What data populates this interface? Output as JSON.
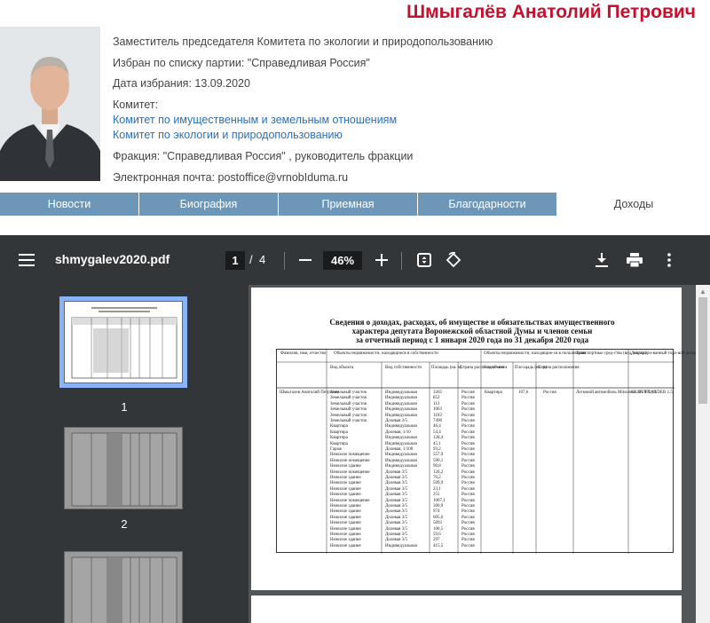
{
  "deputy": {
    "name": "Шмыгалёв Анатолий Петрович",
    "position": "Заместитель председателя Комитета по экологии и природопользованию",
    "elected_by": "Избран по списку партии:  \"Справедливая Россия\"",
    "election_date": "Дата избрания:  13.09.2020",
    "committee_label": "Комитет:",
    "committees": [
      "Комитет по имущественным и земельным отношениям",
      "Комитет по экологии и природопользованию"
    ],
    "faction": "Фракция:  \"Справедливая Россия\" , руководитель фракции",
    "email": "Электронная почта:  postoffice@vrnobIduma.ru"
  },
  "tabs": [
    {
      "label": "Новости",
      "active": false
    },
    {
      "label": "Биография",
      "active": false
    },
    {
      "label": "Приемная",
      "active": false
    },
    {
      "label": "Благодарности",
      "active": false
    },
    {
      "label": "Доходы",
      "active": true
    }
  ],
  "pdf_viewer": {
    "file_name": "shmygalev2020.pdf",
    "current_page": "1",
    "page_separator": "/",
    "total_pages": "4",
    "zoom": "46%",
    "icons": [
      "menu-icon",
      "zoom-out-icon",
      "zoom-in-icon",
      "fit-page-icon",
      "rotate-icon",
      "download-icon",
      "print-icon",
      "more-icon"
    ],
    "thumbnails": [
      "1",
      "2"
    ],
    "colors": {
      "toolbar": "#323639",
      "background": "#525659",
      "selected_thumb": "#8ab4f8"
    }
  },
  "document": {
    "title_lines": [
      "Сведения о доходах, расходах, об имуществе и обязательствах имущественного",
      "характера депутата Воронежской областной Думы и членов семьи",
      "за отчетный период с 1 января 2020 года по 31 декабря 2020 года"
    ],
    "headers": [
      "Фамилия, имя, отчество",
      "Объекты недвижимости, находящиеся в собственности",
      "Объекты недвижимости, находящие-ся в пользовании",
      "Транспортные сред-ства (вид, марка)",
      "Деклариро-ванный годо-вой доход (руб.)"
    ],
    "subheaders": [
      "Вид объекта",
      "Вид собственности",
      "Площадь (кв. м)",
      "Страна распо-ложе-ния",
      "Вид объекта",
      "Пло-щадь (кв. м)",
      "Страна расположения"
    ],
    "person": "Шмыгалев Анатолий Петрович",
    "use_object": "Квартира",
    "use_area": "107,6",
    "use_country": "Россия",
    "vehicle": "Легковой автомобиль Mitsubishi OUT-LANDER 1.5",
    "income": "62 281 870,11",
    "property_rows": [
      [
        "Земельный участок",
        "Индивидуальная",
        "3265",
        "Россия"
      ],
      [
        "Земельный участок",
        "Индивидуальная",
        "852",
        "Россия"
      ],
      [
        "Земельный участок",
        "Индивидуальная",
        "113",
        "Россия"
      ],
      [
        "Земельный участок",
        "Индивидуальная",
        "1063",
        "Россия"
      ],
      [
        "Земельный участок",
        "Индивидуальная",
        "1102",
        "Россия"
      ],
      [
        "Земельный участок",
        "Долевая 3/5",
        "7496",
        "Россия"
      ],
      [
        "Квартира",
        "Индивидуальная",
        "46,4",
        "Россия"
      ],
      [
        "Квартира",
        "Долевая, 1/10",
        "54,4",
        "Россия"
      ],
      [
        "Квартира",
        "Индивидуальная",
        "128,4",
        "Россия"
      ],
      [
        "Квартира",
        "Индивидуальная",
        "45,1",
        "Россия"
      ],
      [
        "Гараж",
        "Долевая, 1/100",
        "93,2",
        "Россия"
      ],
      [
        "Нежилое помещение",
        "Индивидуальная",
        "557,9",
        "Россия"
      ],
      [
        "Нежилое помещение",
        "Индивидуальная",
        "590,1",
        "Россия"
      ],
      [
        "Нежилое здание",
        "Индивидуальная",
        "90,8",
        "Россия"
      ],
      [
        "Нежилое помещение",
        "Долевая 3/5",
        "126,2",
        "Россия"
      ],
      [
        "Нежилое здание",
        "Долевая 3/5",
        "70,2",
        "Россия"
      ],
      [
        "Нежилое здание",
        "Долевая 3/5",
        "509,9",
        "Россия"
      ],
      [
        "Нежилое здание",
        "Долевая 3/5",
        "23,1",
        "Россия"
      ],
      [
        "Нежилое здание",
        "Долевая 3/5",
        "255",
        "Россия"
      ],
      [
        "Нежилое помещение",
        "Долевая 3/5",
        "1007,1",
        "Россия"
      ],
      [
        "Нежилое здание",
        "Долевая 3/5",
        "300,9",
        "Россия"
      ],
      [
        "Нежилое здание",
        "Долевая 3/5",
        "974",
        "Россия"
      ],
      [
        "Нежилое здание",
        "Долевая 3/5",
        "605,6",
        "Россия"
      ],
      [
        "Нежилое здание",
        "Долевая 3/5",
        "5093",
        "Россия"
      ],
      [
        "Нежилое здание",
        "Долевая 3/5",
        "100,5",
        "Россия"
      ],
      [
        "Нежилое здание",
        "Долевая 3/5",
        "59,6",
        "Россия"
      ],
      [
        "Нежилое здание",
        "Долевая 3/5",
        "297",
        "Россия"
      ],
      [
        "Нежилое здание",
        "Индивидуальная",
        "415,5",
        "Россия"
      ]
    ]
  }
}
